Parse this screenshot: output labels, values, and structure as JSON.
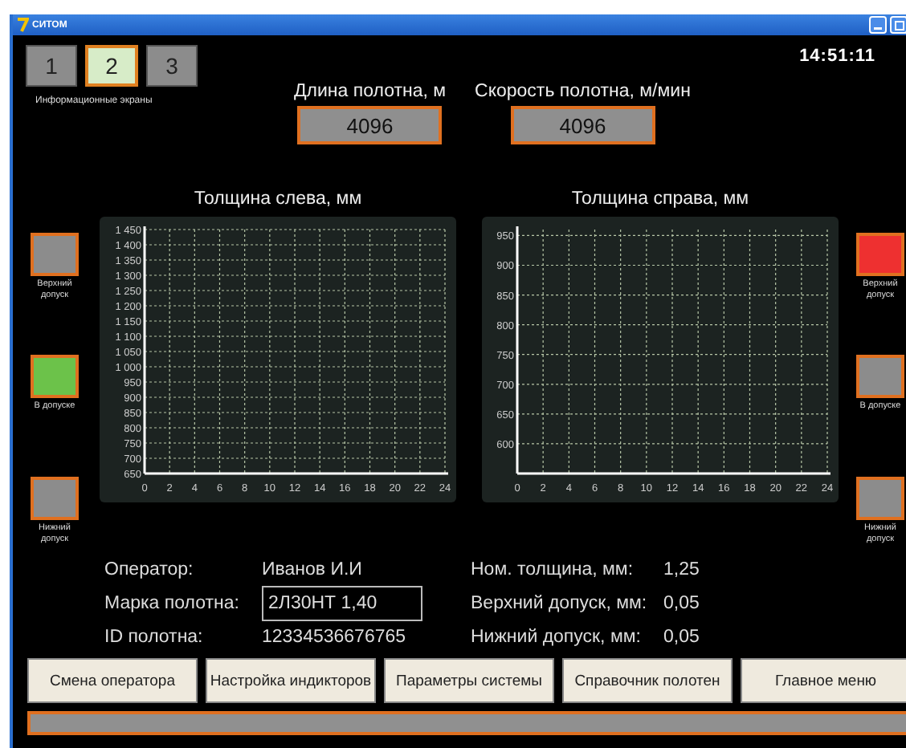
{
  "window": {
    "title": "СИТОМ"
  },
  "screens": {
    "tabs": [
      {
        "label": "1",
        "selected": false
      },
      {
        "label": "2",
        "selected": true
      },
      {
        "label": "3",
        "selected": false
      }
    ],
    "caption": "Информационные экраны"
  },
  "clock": "14:51:11",
  "readouts": [
    {
      "label": "Длина полотна, м",
      "value": "4096"
    },
    {
      "label": "Скорость полотна, м/мин",
      "value": "4096"
    }
  ],
  "left": {
    "title": "Толщина слева, мм",
    "indicators": [
      {
        "label": "Верхний допуск",
        "color": "#8c8c8c"
      },
      {
        "label": "В допуске",
        "color": "#6cc24a"
      },
      {
        "label": "Нижний допуск",
        "color": "#8c8c8c"
      }
    ],
    "chart_data": {
      "type": "line",
      "grid": true,
      "xlim": [
        0,
        24
      ],
      "ylim": [
        650,
        1450
      ],
      "xticks": [
        0,
        2,
        4,
        6,
        8,
        10,
        12,
        14,
        16,
        18,
        20,
        22,
        24
      ],
      "yticks": [
        {
          "value": 1450,
          "label": "1 450"
        },
        {
          "value": 1400,
          "label": "1 400"
        },
        {
          "value": 1350,
          "label": "1 350"
        },
        {
          "value": 1300,
          "label": "1 300"
        },
        {
          "value": 1250,
          "label": "1 250"
        },
        {
          "value": 1200,
          "label": "1 200"
        },
        {
          "value": 1150,
          "label": "1 150"
        },
        {
          "value": 1100,
          "label": "1 100"
        },
        {
          "value": 1050,
          "label": "1 050"
        },
        {
          "value": 1000,
          "label": "1 000"
        },
        950,
        900,
        850,
        800,
        750,
        700,
        650
      ]
    }
  },
  "right": {
    "title": "Толщина справа, мм",
    "indicators": [
      {
        "label": "Верхний допуск",
        "color": "#ee3030"
      },
      {
        "label": "В допуске",
        "color": "#8c8c8c"
      },
      {
        "label": "Нижний допуск",
        "color": "#8c8c8c"
      }
    ],
    "chart_data": {
      "type": "line",
      "grid": true,
      "xlim": [
        0,
        24
      ],
      "ylim": [
        550,
        960
      ],
      "xticks": [
        0,
        2,
        4,
        6,
        8,
        10,
        12,
        14,
        16,
        18,
        20,
        22,
        24
      ],
      "yticks": [
        950,
        900,
        850,
        800,
        750,
        700,
        650,
        600
      ]
    }
  },
  "info_left": [
    {
      "label": "Оператор:",
      "value": "Иванов И.И",
      "kind": "text"
    },
    {
      "label": "Марка полотна:",
      "value": "2Л30НТ 1,40",
      "kind": "field"
    },
    {
      "label": "ID полотна:",
      "value": "12334536676765",
      "kind": "text"
    }
  ],
  "info_right": [
    {
      "label": "Ном. толщина, мм:",
      "value": "1,25"
    },
    {
      "label": "Верхний допуск, мм:",
      "value": "0,05"
    },
    {
      "label": "Нижний допуск, мм:",
      "value": "0,05"
    }
  ],
  "buttons": [
    "Смена оператора",
    "Настройка индикторов",
    "Параметры системы",
    "Справочник полотен",
    "Главное меню"
  ]
}
